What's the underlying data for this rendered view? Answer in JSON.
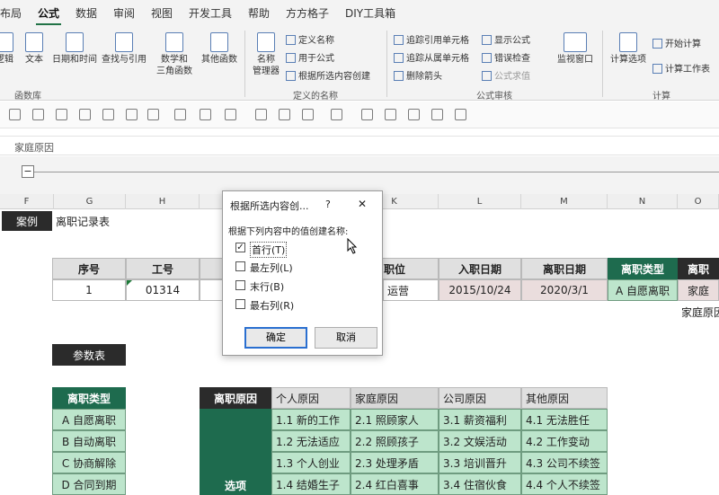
{
  "menu": {
    "tabs": [
      "布局",
      "公式",
      "数据",
      "审阅",
      "视图",
      "开发工具",
      "帮助",
      "方方格子",
      "DIY工具箱"
    ],
    "active": "公式"
  },
  "ribbon": {
    "function_library": {
      "group_label": "函数库",
      "buttons": [
        "逻辑",
        "文本",
        "日期和时间",
        "查找与引用",
        "数学和\n三角函数",
        "其他函数"
      ]
    },
    "defined_names": {
      "group_label": "定义的名称",
      "name_manager": "名称\n管理器",
      "define_name": "定义名称",
      "use_in_formula": "用于公式",
      "create_from_selection": "根据所选内容创建"
    },
    "formula_auditing": {
      "group_label": "公式审核",
      "trace_precedents": "追踪引用单元格",
      "trace_dependents": "追踪从属单元格",
      "remove_arrows": "删除箭头",
      "show_formulas": "显示公式",
      "error_checking": "错误检查",
      "evaluate_formula": "公式求值",
      "watch_window": "监视窗口"
    },
    "calculation": {
      "group_label": "计算",
      "calc_options": "计算选项",
      "calc_now": "开始计算",
      "calc_sheet": "计算工作表"
    }
  },
  "formula_bar": {
    "value": "家庭原因"
  },
  "outline": {
    "collapse_button": "−"
  },
  "columns": [
    "F",
    "G",
    "H",
    "I",
    "J",
    "K",
    "L",
    "M",
    "N",
    "O"
  ],
  "sheet": {
    "case_label": "案例",
    "title": "离职记录表",
    "headers": [
      "序号",
      "工号",
      "职位",
      "入职日期",
      "离职日期",
      "离职类型",
      "离职"
    ],
    "row1": [
      "1",
      "01314",
      "运营",
      "2015/10/24",
      "2020/3/1",
      "A 自愿离职",
      "家庭"
    ],
    "overflow_text": "家庭原因",
    "param_label": "参数表",
    "type_header": "离职类型",
    "types": [
      "A 自愿离职",
      "B 自动离职",
      "C 协商解除",
      "D 合同到期"
    ],
    "reason_header": "离职原因",
    "option_label": "选项",
    "reason_cols": [
      "个人原因",
      "家庭原因",
      "公司原因",
      "其他原因"
    ],
    "reason_rows": [
      [
        "1.1 新的工作",
        "2.1 照顾家人",
        "3.1 薪资福利",
        "4.1 无法胜任"
      ],
      [
        "1.2 无法适应",
        "2.2 照顾孩子",
        "3.2 文娱活动",
        "4.2 工作变动"
      ],
      [
        "1.3 个人创业",
        "2.3 处理矛盾",
        "3.3 培训晋升",
        "4.3 公司不续签"
      ],
      [
        "1.4 结婚生子",
        "2.4 红白喜事",
        "3.4 住宿伙食",
        "4.4 个人不续签"
      ]
    ]
  },
  "dialog": {
    "title": "根据所选内容创...",
    "help": "?",
    "close": "✕",
    "prompt": "根据下列内容中的值创建名称:",
    "options": [
      {
        "label": "首行(T)",
        "checked": true
      },
      {
        "label": "最左列(L)",
        "checked": false
      },
      {
        "label": "末行(B)",
        "checked": false
      },
      {
        "label": "最右列(R)",
        "checked": false
      }
    ],
    "ok": "确定",
    "cancel": "取消"
  },
  "colors": {
    "accent_green": "#1e6b4e",
    "light_green": "#bde5cc",
    "dark_label": "#2b2b2b",
    "excel_green": "#217346"
  }
}
